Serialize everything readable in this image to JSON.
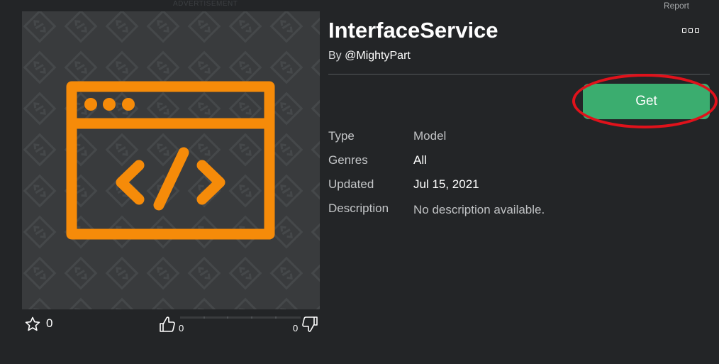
{
  "ad_label": "ADVERTISEMENT",
  "report_label": "Report",
  "item": {
    "title": "InterfaceService",
    "creator_prefix": "By ",
    "creator_handle": "@MightyPart",
    "get_label": "Get"
  },
  "details": [
    {
      "label": "Type",
      "value": "Model"
    },
    {
      "label": "Genres",
      "value": "All"
    },
    {
      "label": "Updated",
      "value": "Jul 15, 2021"
    },
    {
      "label": "Description",
      "value": "No description available."
    }
  ],
  "stats": {
    "favorites": "0",
    "upvotes": "0",
    "downvotes": "0"
  },
  "colors": {
    "accent_orange": "#f68b09",
    "get_green": "#3bad6f",
    "highlight_ring": "#e0121b"
  },
  "icons": {
    "thumbnail": "code-window-icon",
    "favorite": "star-icon",
    "upvote": "thumbs-up-icon",
    "downvote": "thumbs-down-icon",
    "more": "more-dots-icon"
  }
}
